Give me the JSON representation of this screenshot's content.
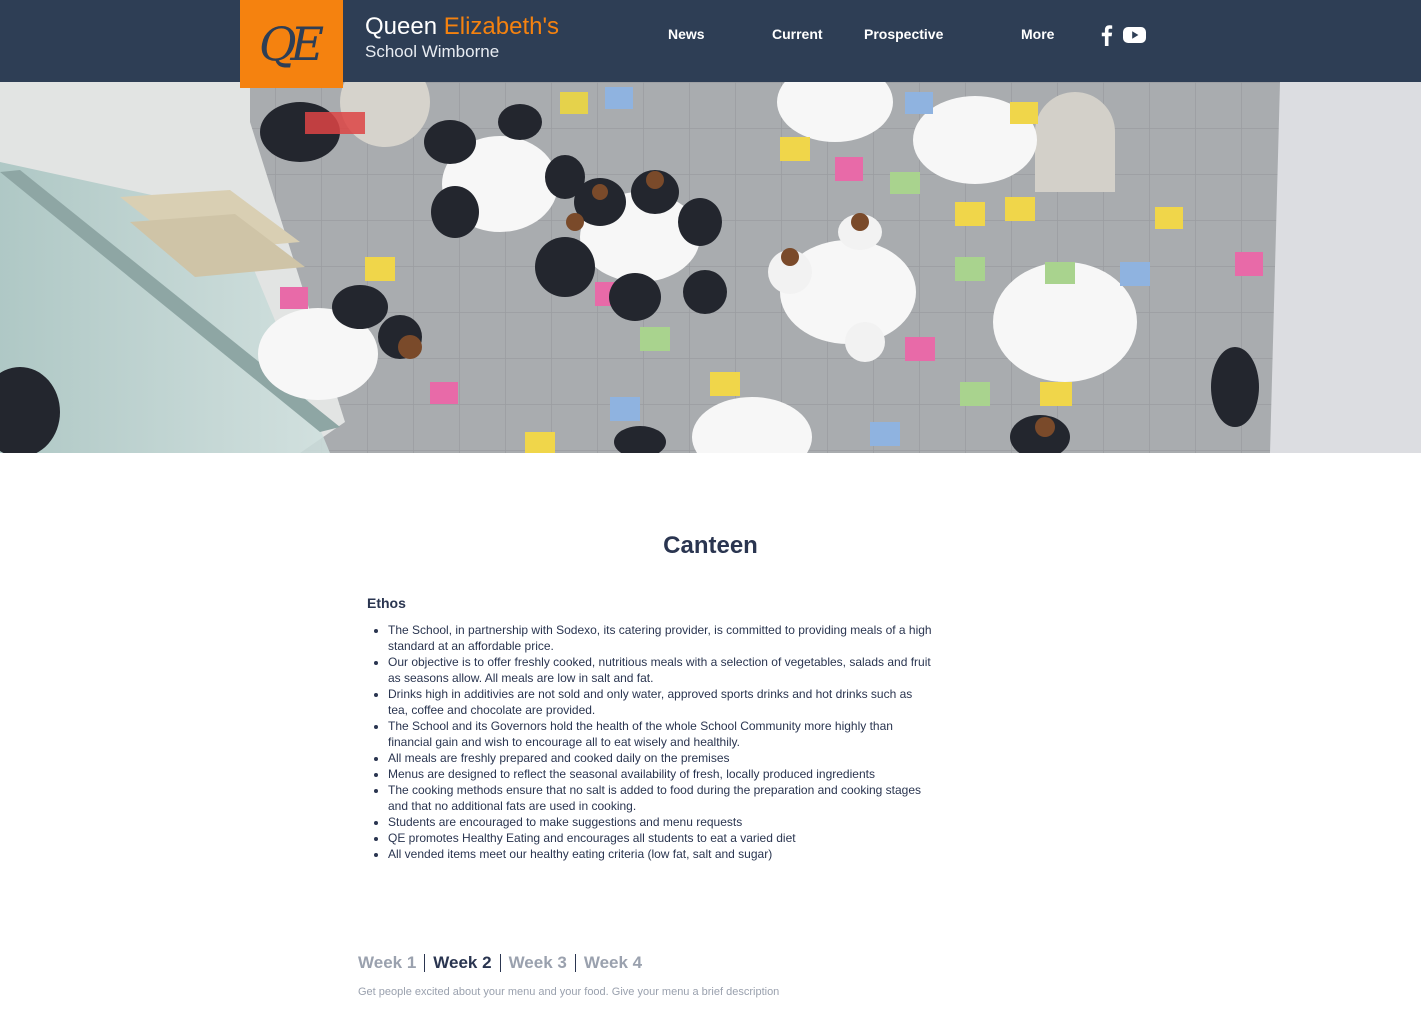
{
  "header": {
    "logo_text": "QE",
    "brand_first": "Queen ",
    "brand_accent": "Elizabeth's",
    "brand_second_line": "School Wimborne",
    "accent_color": "#f5820f",
    "bar_color": "#2e3e55"
  },
  "nav": {
    "items": [
      {
        "label": "News"
      },
      {
        "label": "Current"
      },
      {
        "label": "Prospective"
      },
      {
        "label": "More"
      }
    ],
    "social": [
      {
        "icon": "facebook-icon"
      },
      {
        "icon": "youtube-icon"
      }
    ]
  },
  "hero": {
    "icon": "canteen-photo",
    "description_visible": false
  },
  "content": {
    "title": "Canteen",
    "ethos_heading": "Ethos",
    "ethos_items": [
      "The School, in partnership with Sodexo, its catering provider, is committed to providing meals of a high standard at an affordable price.",
      "Our objective is to offer freshly cooked, nutritious meals with a selection of vegetables, salads and fruit as seasons allow. All meals are low in salt and fat.",
      "Drinks high in additivies are not sold and only water, approved sports drinks and hot drinks such as tea, coffee and chocolate are provided.",
      "The School and its Governors hold the health of the whole School Community more highly than financial gain and wish to encourage all to eat wisely and healthily.",
      "All meals are freshly prepared and cooked daily on the premises",
      "Menus are designed to reflect the seasonal availability of fresh, locally produced ingredients",
      "The cooking methods ensure that no salt is added to food during the preparation and cooking stages and that no additional fats are used in cooking.",
      "Students are encouraged to make suggestions and menu requests",
      "QE promotes Healthy Eating and encourages all students to eat a varied diet",
      "All vended items meet our healthy eating criteria (low fat, salt and sugar)"
    ]
  },
  "menu": {
    "tabs": [
      {
        "label": "Week 1",
        "active": false
      },
      {
        "label": "Week 2",
        "active": true
      },
      {
        "label": "Week 3",
        "active": false
      },
      {
        "label": "Week 4",
        "active": false
      }
    ],
    "description": "Get people excited about your menu and your food. Give your menu a brief description"
  }
}
